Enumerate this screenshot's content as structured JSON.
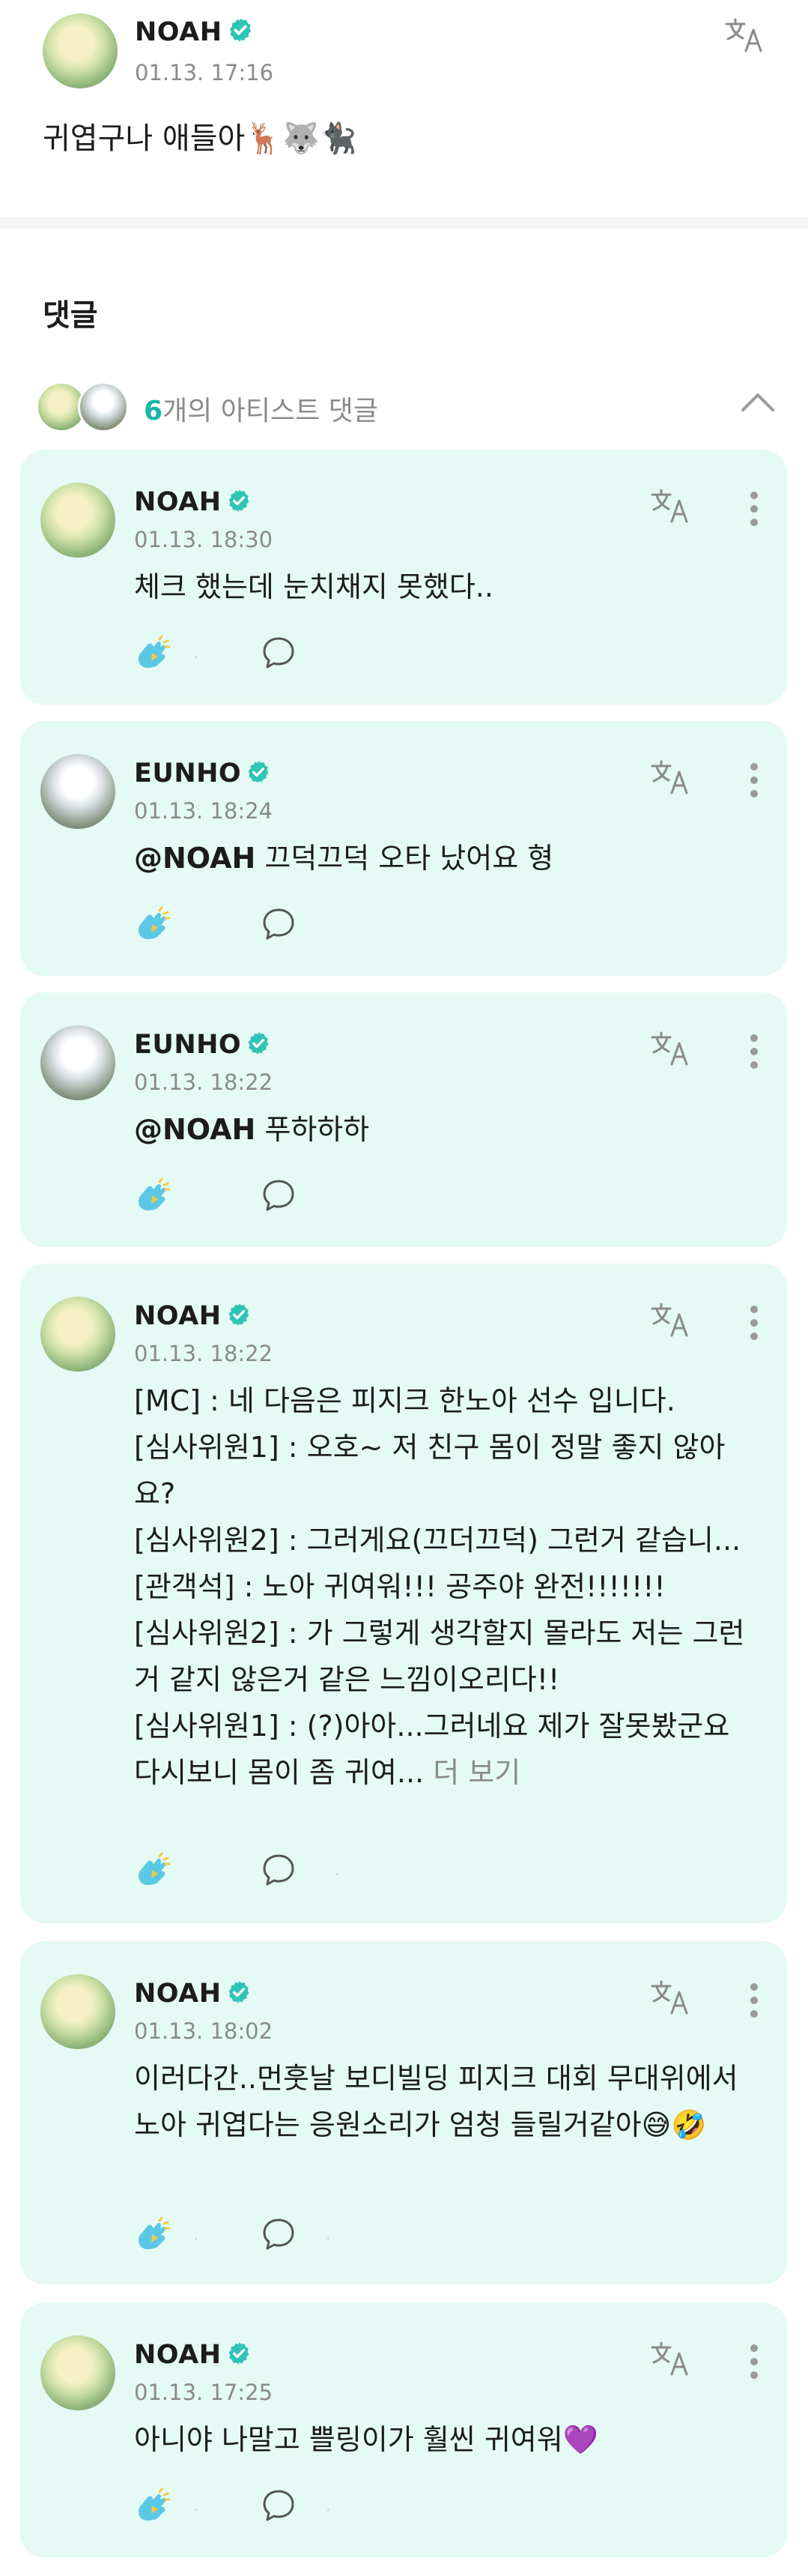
{
  "post": {
    "author": "NOAH",
    "time": "01.13. 17:16",
    "text": "귀엽구나 애들아🦌🐺🐈‍⬛"
  },
  "comments_section": {
    "title": "댓글",
    "artist_count": "6",
    "artist_label": "개의 아티스트 댓글"
  },
  "comments": [
    {
      "author": "NOAH",
      "time": "01.13. 18:30",
      "text": "체크 했는데 눈치채지 못했다..",
      "mention": "",
      "more": ""
    },
    {
      "author": "EUNHO",
      "time": "01.13. 18:24",
      "text": " 끄덕끄덕 오타 났어요 형",
      "mention": "@NOAH",
      "more": ""
    },
    {
      "author": "EUNHO",
      "time": "01.13. 18:22",
      "text": " 푸하하하",
      "mention": "@NOAH",
      "more": ""
    },
    {
      "author": "NOAH",
      "time": "01.13. 18:22",
      "text": "[MC] : 네 다음은 피지크 한노아 선수 입니다.\n[심사위원1] : 오호~ 저 친구 몸이 정말 좋지 않아요?\n[심사위원2] : 그러게요(끄더끄덕) 그런거 같습니...\n[관객석] : 노아 귀여워!!! 공주야 완전!!!!!!!\n[심사위원2] : 가 그렇게 생각할지 몰라도 저는 그런거 같지 않은거 같은 느낌이오리다!!\n[심사위원1] : (?)아아...그러네요 제가 잘못봤군요 다시보니 몸이 좀 귀여...",
      "mention": "",
      "more": " 더 보기"
    },
    {
      "author": "NOAH",
      "time": "01.13. 18:02",
      "text": "이러다간..먼훗날 보디빌딩 피지크 대회 무대위에서 노아 귀엽다는 응원소리가 엄청 들릴거같아😅🤣",
      "mention": "",
      "more": ""
    },
    {
      "author": "NOAH",
      "time": "01.13. 17:25",
      "text": "아니야 나말고 쁠링이가 훨씬 귀여워💜",
      "mention": "",
      "more": ""
    }
  ],
  "icons": {
    "verified": "verified-badge-icon",
    "translate": "translate-icon",
    "more": "kebab-menu-icon",
    "cheer": "cheer-hand-icon",
    "reply": "comment-bubble-icon",
    "collapse": "chevron-up-icon"
  },
  "colors": {
    "accent": "#1ab5a8",
    "verified": "#2ec4b6",
    "card_bg": "#e5faf4",
    "muted": "#8a8a8a"
  }
}
